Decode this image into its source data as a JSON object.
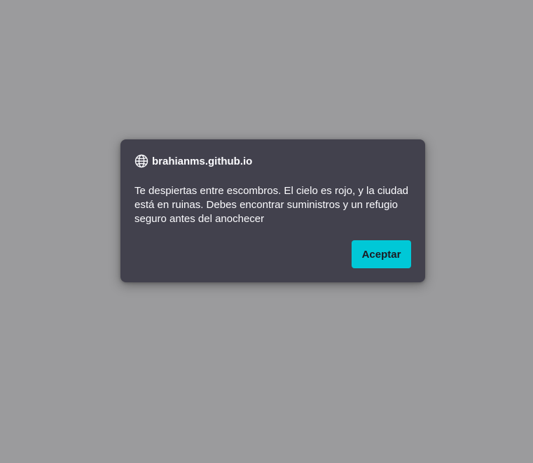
{
  "dialog": {
    "origin": "brahianms.github.io",
    "origin_icon": "globe-icon",
    "message": "Te despiertas entre escombros. El cielo es rojo, y la ciudad está en ruinas. Debes encontrar suministros y un refugio seguro antes del anochecer",
    "accept_label": "Aceptar"
  },
  "colors": {
    "overlay": "#9b9b9d",
    "dialog_bg": "#42414d",
    "text": "#fbfbfe",
    "button_bg": "#00c8d7",
    "button_text": "#1c1b22"
  }
}
